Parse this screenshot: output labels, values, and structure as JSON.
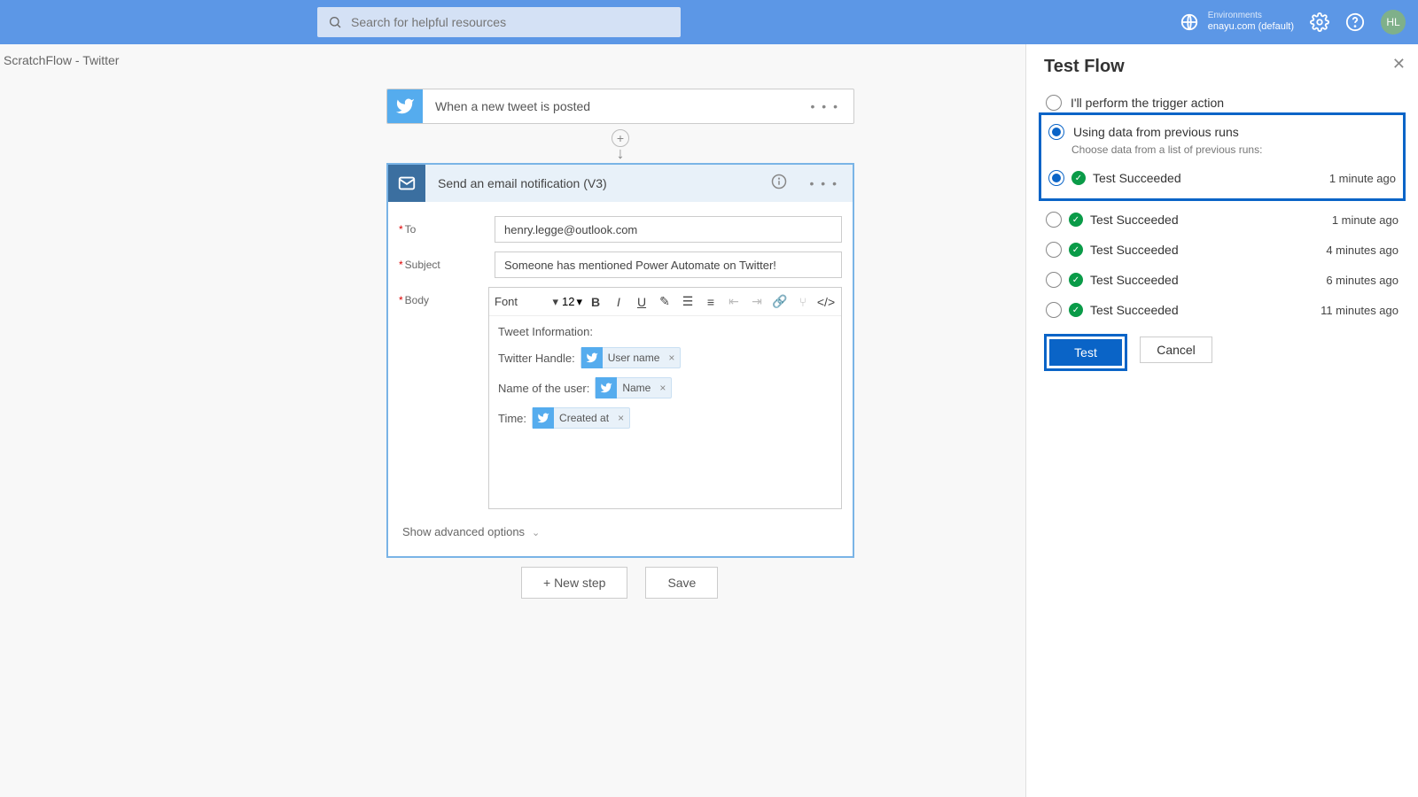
{
  "top": {
    "search_placeholder": "Search for helpful resources",
    "env_label": "Environments",
    "env_value": "enayu.com (default)",
    "avatar": "HL"
  },
  "crumb": "ScratchFlow - Twitter",
  "trigger": {
    "title": "When a new tweet is posted"
  },
  "action": {
    "title": "Send an email notification (V3)",
    "fields": {
      "to_label": "To",
      "to_value": "henry.legge@outlook.com",
      "subject_label": "Subject",
      "subject_value": "Someone has mentioned Power Automate on Twitter!",
      "body_label": "Body"
    },
    "editor": {
      "font": "Font",
      "font_size": "12",
      "intro": "Tweet Information:",
      "line1_label": "Twitter Handle:",
      "line1_token": "User name",
      "line2_label": "Name of the user:",
      "line2_token": "Name",
      "line3_label": "Time:",
      "line3_token": "Created at"
    },
    "advanced": "Show advanced options"
  },
  "bottom": {
    "new_step": "+ New step",
    "save": "Save"
  },
  "panel": {
    "title": "Test Flow",
    "opt_manual": "I'll perform the trigger action",
    "opt_prev": "Using data from previous runs",
    "opt_prev_sub": "Choose data from a list of previous runs:",
    "runs": [
      {
        "label": "Test Succeeded",
        "time": "1 minute ago"
      },
      {
        "label": "Test Succeeded",
        "time": "1 minute ago"
      },
      {
        "label": "Test Succeeded",
        "time": "4 minutes ago"
      },
      {
        "label": "Test Succeeded",
        "time": "6 minutes ago"
      },
      {
        "label": "Test Succeeded",
        "time": "11 minutes ago"
      }
    ],
    "test": "Test",
    "cancel": "Cancel"
  }
}
